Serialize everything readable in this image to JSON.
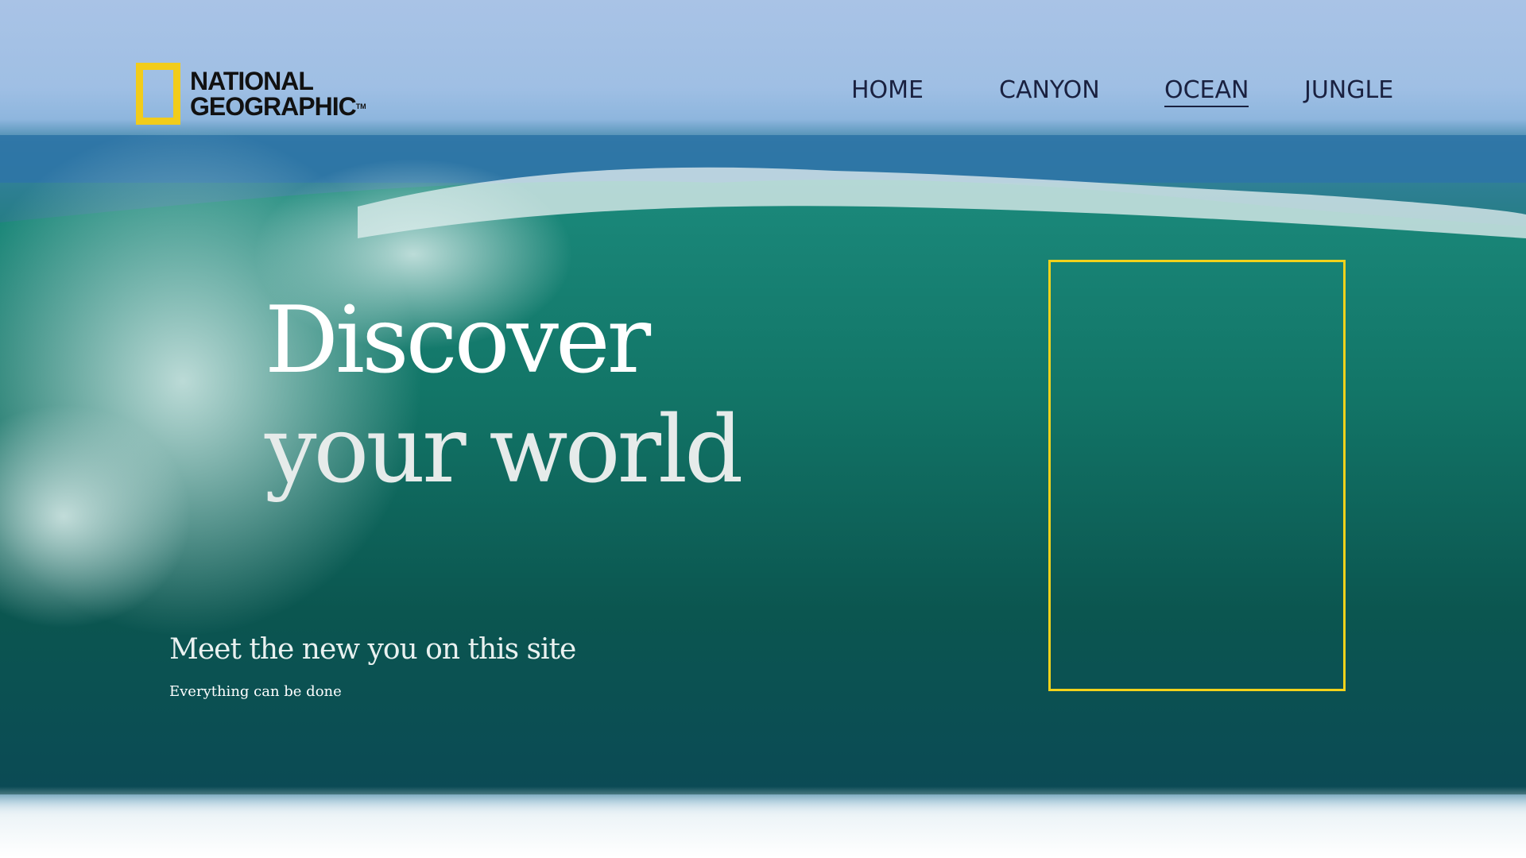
{
  "brand": {
    "line1": "NATIONAL",
    "line2": "GEOGRAPHIC",
    "trademark": "TM",
    "frame_color": "#f2cc1a"
  },
  "nav": {
    "items": [
      {
        "label": "HOME",
        "active": false
      },
      {
        "label": "CANYON",
        "active": false
      },
      {
        "label": "OCEAN",
        "active": true
      },
      {
        "label": "JUNGLE",
        "active": false
      }
    ]
  },
  "hero": {
    "title_line1": "Discover",
    "title_line2": "your world",
    "subtitle": "Meet the new you on this site",
    "caption": "Everything can be done"
  },
  "accent_color": "#f2d21b"
}
